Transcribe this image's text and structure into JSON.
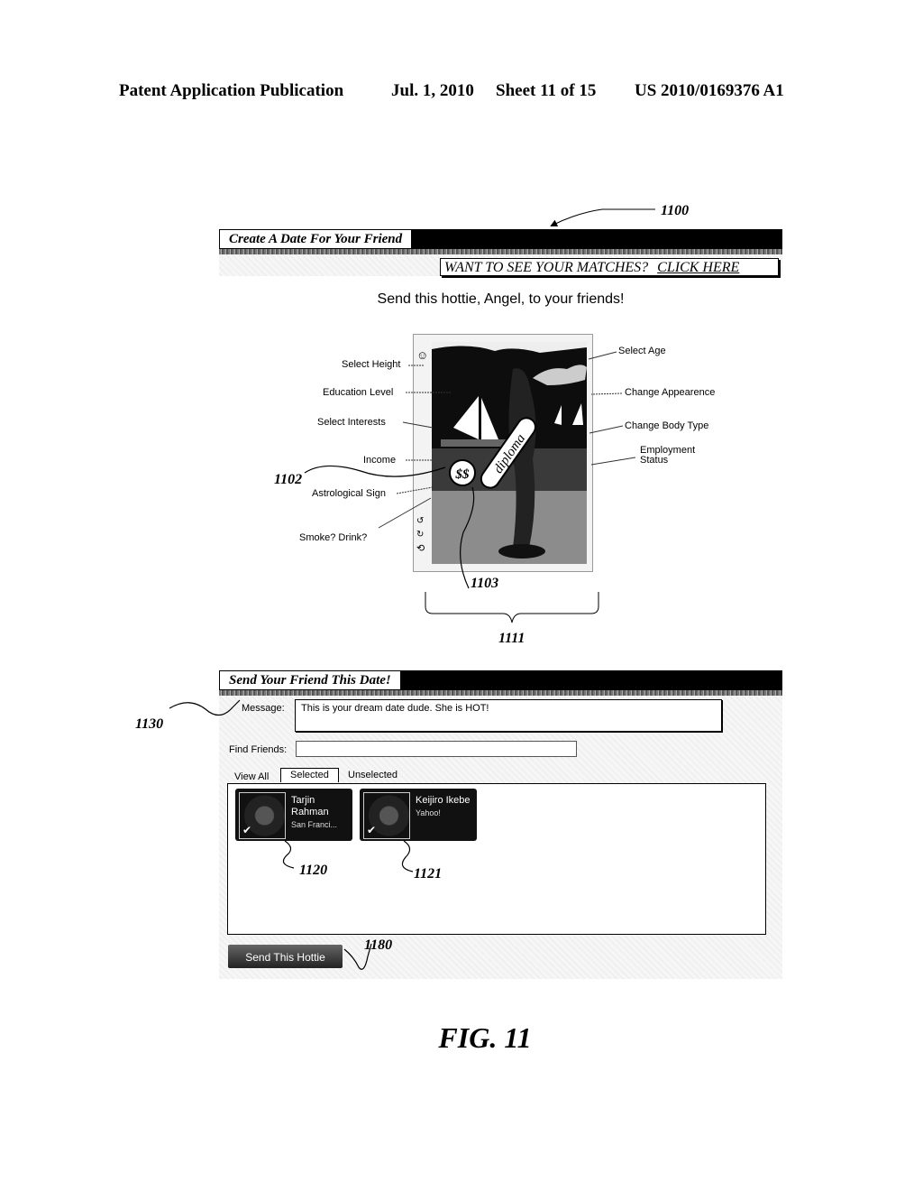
{
  "patent_header": {
    "publication": "Patent Application Publication",
    "date": "Jul. 1, 2010",
    "sheet": "Sheet 11 of 15",
    "number": "US 2010/0169376 A1"
  },
  "reference_numerals": {
    "ui": "1100",
    "income_badge": "1102",
    "diploma_badge": "1103",
    "photo_region": "1111",
    "message_field": "1130",
    "friend_card_1": "1120",
    "friend_card_2": "1121",
    "send_button": "1180"
  },
  "create_section": {
    "title": "Create A Date For Your Friend",
    "matches_prompt": "WANT TO SEE YOUR MATCHES?",
    "matches_link": "CLICK HERE",
    "headline": "Send this hottie, Angel, to your friends!",
    "photo": {
      "income_badge": "$$",
      "education_badge": "diploma",
      "side_icons": [
        "smiley-icon",
        "rotate-left-icon",
        "rotate-icon",
        "undo-icon"
      ]
    },
    "left_labels": [
      "Select Height",
      "Education Level",
      "Select Interests",
      "Income",
      "Astrological Sign",
      "Smoke? Drink?"
    ],
    "right_labels": [
      "Select Age",
      "Change Appearence",
      "Change Body Type",
      "Employment Status"
    ]
  },
  "send_section": {
    "title": "Send Your Friend This Date!",
    "message_label": "Message:",
    "message_value": "This is your dream date dude.  She is HOT!",
    "find_label": "Find Friends:",
    "find_value": "",
    "tabs": [
      {
        "label": "View All",
        "active": false
      },
      {
        "label": "Selected",
        "active": true
      },
      {
        "label": "Unselected",
        "active": false
      }
    ],
    "friends": [
      {
        "name": "Tarjin Rahman",
        "network": "San Franci...",
        "selected": true
      },
      {
        "name": "Keijiro Ikebe",
        "network": "Yahoo!",
        "selected": true
      }
    ],
    "send_button": "Send This Hottie"
  },
  "figure_label": "FIG. 11"
}
